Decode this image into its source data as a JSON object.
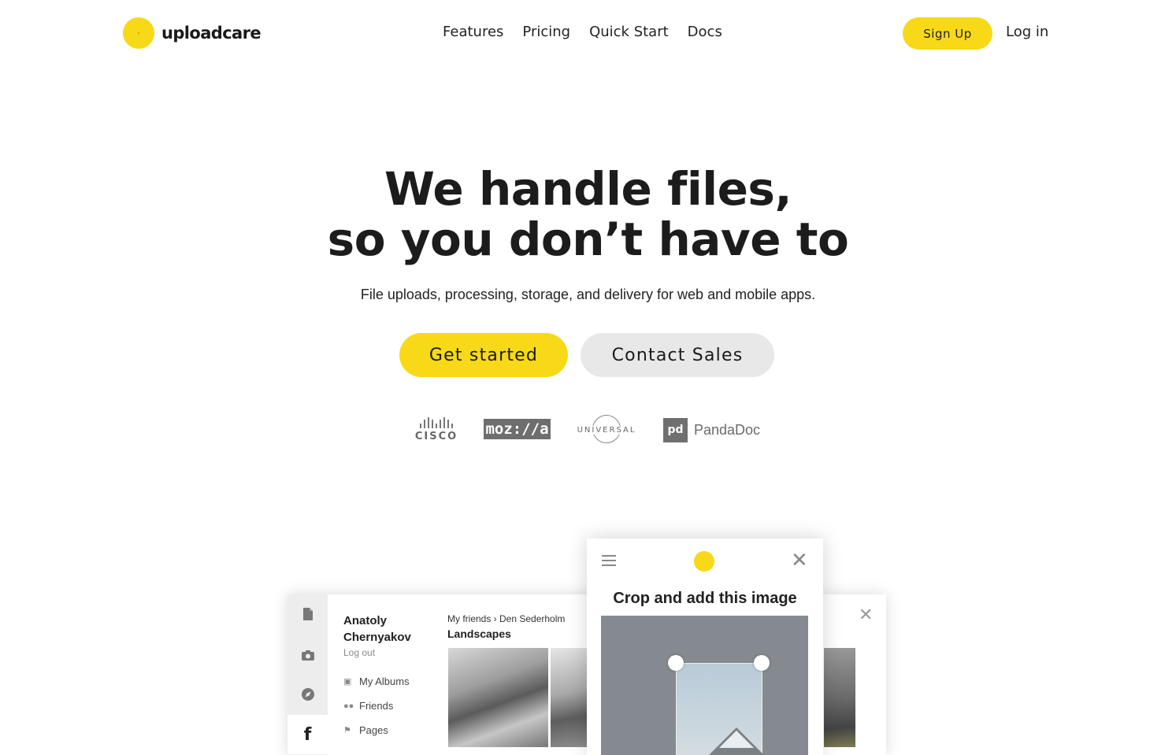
{
  "header": {
    "brand": "uploadcare",
    "nav": [
      "Features",
      "Pricing",
      "Quick Start",
      "Docs"
    ],
    "signup_label": "Sign Up",
    "login_label": "Log in"
  },
  "hero": {
    "title_line1": "We handle files,",
    "title_line2": "so you don’t have to",
    "subtitle": "File uploads, processing, storage, and delivery for web and mobile apps.",
    "primary_cta": "Get started",
    "secondary_cta": "Contact Sales"
  },
  "clients": {
    "cisco": "CISCO",
    "mozilla": "moz://a",
    "universal": "UNIVERSAL",
    "pandadoc_mark": "pd",
    "pandadoc": "PandaDoc"
  },
  "widget": {
    "user_name": "Anatoly Chernyakov",
    "logout": "Log out",
    "links": [
      "My Albums",
      "Friends",
      "Pages"
    ],
    "breadcrumb": "My friends › Den Sederholm",
    "album_title": "Landscapes",
    "rail_icons": [
      "file-icon",
      "camera-icon",
      "compass-icon",
      "facebook-icon"
    ],
    "facebook_glyph": "f",
    "modal_title": "Crop and add this image"
  },
  "colors": {
    "brand_yellow": "#f7d918",
    "secondary_button": "#e8e8e8",
    "text": "#1a1a1a"
  }
}
